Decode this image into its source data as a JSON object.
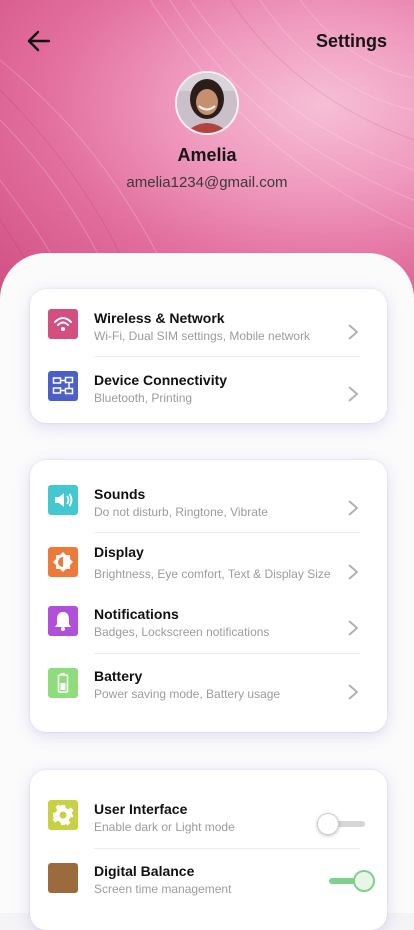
{
  "header": {
    "title": "Settings",
    "back_icon": "arrow-left-icon"
  },
  "profile": {
    "name": "Amelia",
    "email": "amelia1234@gmail.com"
  },
  "groups": [
    {
      "items": [
        {
          "title": "Wireless & Network",
          "subtitle": "Wi-Fi, Dual SIM settings, Mobile network",
          "icon": "wifi-icon",
          "color": "#d24f80"
        },
        {
          "title": "Device Connectivity",
          "subtitle": "Bluetooth, Printing",
          "icon": "device-connectivity-icon",
          "color": "#4b5fc8"
        }
      ]
    },
    {
      "items": [
        {
          "title": "Sounds",
          "subtitle": "Do not disturb, Ringtone, Vibrate",
          "icon": "speaker-icon",
          "color": "#43c8d0"
        },
        {
          "title": "Display",
          "subtitle": "Brightness, Eye comfort, Text & Display Size",
          "icon": "brightness-icon",
          "color": "#ee7a39"
        },
        {
          "title": "Notifications",
          "subtitle": "Badges, Lockscreen notifications",
          "icon": "bell-icon",
          "color": "#b04fd8"
        },
        {
          "title": "Battery",
          "subtitle": "Power saving mode, Battery usage",
          "icon": "battery-icon",
          "color": "#8fdc7c"
        }
      ]
    },
    {
      "items": [
        {
          "title": "User Interface",
          "subtitle": "Enable dark or Light mode",
          "icon": "gear-icon",
          "color": "#c8d044",
          "toggle": false
        },
        {
          "title": "Digital Balance",
          "subtitle": "Screen time management",
          "icon": "digital-balance-icon",
          "color": "#9b6b3e",
          "toggle": true
        }
      ]
    }
  ],
  "colors": {
    "toggle_on": "#7ed08a",
    "toggle_off": "#d6d6d6",
    "chevron": "#b3b3b3"
  }
}
